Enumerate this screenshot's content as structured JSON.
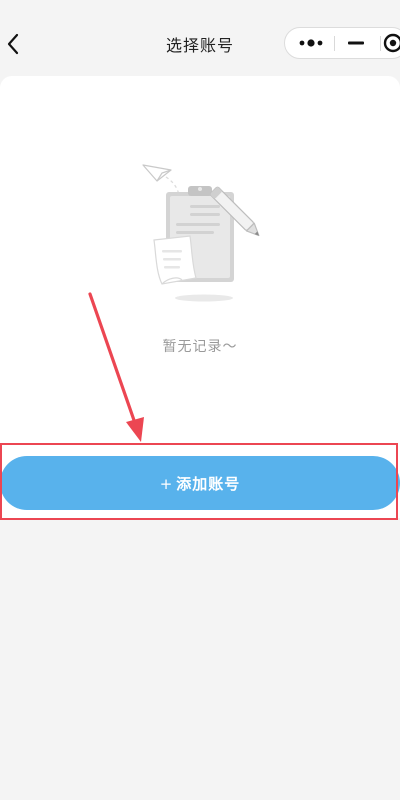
{
  "nav": {
    "title": "选择账号",
    "back_icon": "chevron-left-icon",
    "capsule": {
      "more_icon": "more-dots-icon",
      "minimize_icon": "minimize-icon",
      "close_icon": "target-close-icon"
    }
  },
  "empty_state": {
    "illustration_icon": "empty-clipboard-illustration",
    "message": "暂无记录～"
  },
  "actions": {
    "add_account_plus": "+",
    "add_account_label": "添加账号"
  },
  "colors": {
    "primary_button": "#58b2ec",
    "annotation": "#ec4652",
    "background": "#f4f4f4",
    "card": "#ffffff",
    "muted_text": "#9a9a9a"
  }
}
